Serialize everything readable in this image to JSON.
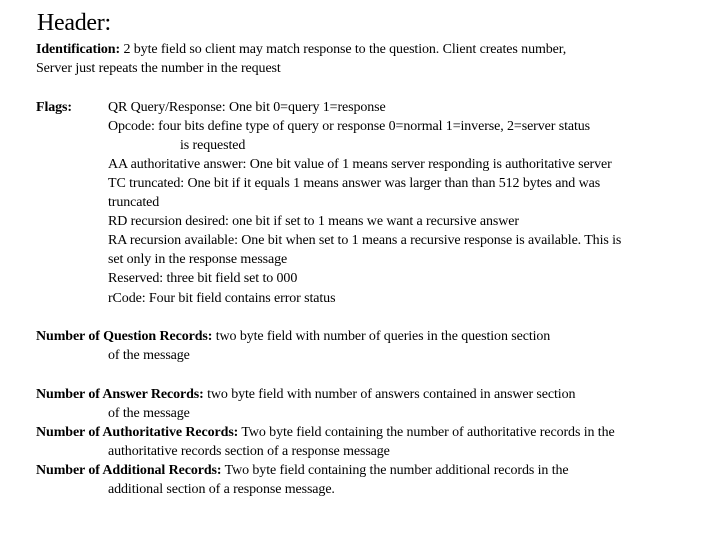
{
  "title": "Header:",
  "identification": {
    "label": "Identification:",
    "line1": " 2 byte field so client may match response to the question. Client creates number,",
    "line2": "Server just repeats the number in the request"
  },
  "flags": {
    "label": "Flags:",
    "lines": [
      "QR Query/Response: One bit 0=query  1=response",
      "Opcode: four bits define type of query or response 0=normal  1=inverse, 2=server status",
      "is requested",
      "AA authoritative answer: One bit value of 1 means server responding is authoritative server",
      "TC truncated: One bit if it equals 1 means answer was larger than than 512 bytes and was",
      "truncated",
      "RD recursion desired: one bit if set to 1 means we want a recursive answer",
      "RA recursion available: One bit when set to 1 means a recursive response is available. This is",
      "set only in the response message",
      "Reserved: three bit field set to 000",
      "rCode: Four bit field contains error status"
    ]
  },
  "records": [
    {
      "label": "Number of Question Records:",
      "text": " two byte field with number of queries in the question section",
      "cont": "of the message"
    },
    {
      "label": "Number of Answer Records:",
      "text": " two byte field with number of answers contained in answer section",
      "cont": "of the message"
    },
    {
      "label": "Number of Authoritative Records:",
      "text": " Two byte field containing the number of authoritative records in the",
      "cont": "authoritative records section of a response message"
    },
    {
      "label": "Number of Additional Records:",
      "text": " Two byte field containing the number additional records in the",
      "cont": "additional section of a response message."
    }
  ]
}
